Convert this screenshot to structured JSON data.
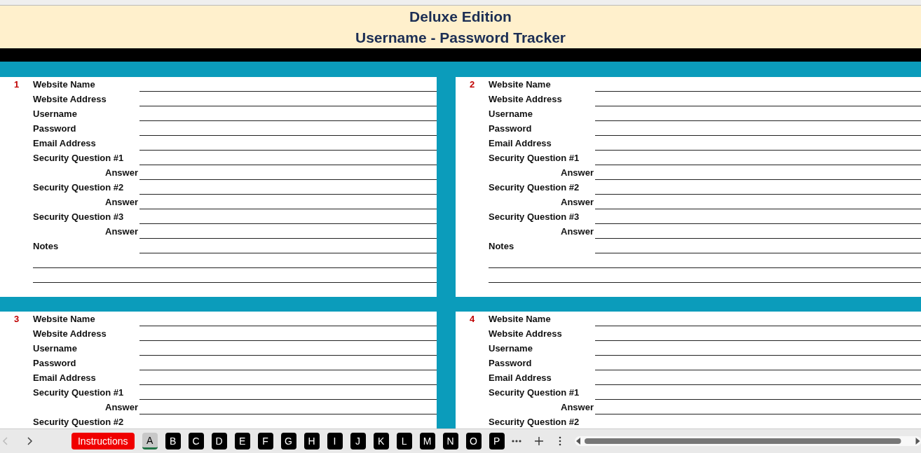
{
  "title": {
    "edition": "Deluxe Edition",
    "name": "Username - Password Tracker"
  },
  "records": [
    {
      "number": "1",
      "fields": [
        {
          "label": "Website Name",
          "kind": "field"
        },
        {
          "label": "Website Address",
          "kind": "field"
        },
        {
          "label": "Username",
          "kind": "field"
        },
        {
          "label": "Password",
          "kind": "field"
        },
        {
          "label": "Email Address",
          "kind": "field"
        },
        {
          "label": "Security Question #1",
          "kind": "field"
        },
        {
          "label": "Answer",
          "kind": "answer"
        },
        {
          "label": "Security Question #2",
          "kind": "field"
        },
        {
          "label": "Answer",
          "kind": "answer"
        },
        {
          "label": "Security Question #3",
          "kind": "field"
        },
        {
          "label": "Answer",
          "kind": "answer"
        },
        {
          "label": "Notes",
          "kind": "notes"
        }
      ]
    },
    {
      "number": "2",
      "fields": [
        {
          "label": "Website Name",
          "kind": "field"
        },
        {
          "label": "Website Address",
          "kind": "field"
        },
        {
          "label": "Username",
          "kind": "field"
        },
        {
          "label": "Password",
          "kind": "field"
        },
        {
          "label": "Email Address",
          "kind": "field"
        },
        {
          "label": "Security Question #1",
          "kind": "field"
        },
        {
          "label": "Answer",
          "kind": "answer"
        },
        {
          "label": "Security Question #2",
          "kind": "field"
        },
        {
          "label": "Answer",
          "kind": "answer"
        },
        {
          "label": "Security Question #3",
          "kind": "field"
        },
        {
          "label": "Answer",
          "kind": "answer"
        },
        {
          "label": "Notes",
          "kind": "notes"
        }
      ]
    },
    {
      "number": "3",
      "fields": [
        {
          "label": "Website Name",
          "kind": "field"
        },
        {
          "label": "Website Address",
          "kind": "field"
        },
        {
          "label": "Username",
          "kind": "field"
        },
        {
          "label": "Password",
          "kind": "field"
        },
        {
          "label": "Email Address",
          "kind": "field"
        },
        {
          "label": "Security Question #1",
          "kind": "field"
        },
        {
          "label": "Answer",
          "kind": "answer"
        },
        {
          "label": "Security Question #2",
          "kind": "field"
        }
      ]
    },
    {
      "number": "4",
      "fields": [
        {
          "label": "Website Name",
          "kind": "field"
        },
        {
          "label": "Website Address",
          "kind": "field"
        },
        {
          "label": "Username",
          "kind": "field"
        },
        {
          "label": "Password",
          "kind": "field"
        },
        {
          "label": "Email Address",
          "kind": "field"
        },
        {
          "label": "Security Question #1",
          "kind": "field"
        },
        {
          "label": "Answer",
          "kind": "answer"
        },
        {
          "label": "Security Question #2",
          "kind": "field"
        }
      ]
    }
  ],
  "sheet_tabs": [
    {
      "label": "Instructions",
      "kind": "instructions",
      "selected": false
    },
    {
      "label": "A",
      "kind": "letter",
      "selected": true
    },
    {
      "label": "B",
      "kind": "letter",
      "selected": false
    },
    {
      "label": "C",
      "kind": "letter",
      "selected": false
    },
    {
      "label": "D",
      "kind": "letter",
      "selected": false
    },
    {
      "label": "E",
      "kind": "letter",
      "selected": false
    },
    {
      "label": "F",
      "kind": "letter",
      "selected": false
    },
    {
      "label": "G",
      "kind": "letter",
      "selected": false
    },
    {
      "label": "H",
      "kind": "letter",
      "selected": false
    },
    {
      "label": "I",
      "kind": "letter",
      "selected": false
    },
    {
      "label": "J",
      "kind": "letter",
      "selected": false
    },
    {
      "label": "K",
      "kind": "letter",
      "selected": false
    },
    {
      "label": "L",
      "kind": "letter",
      "selected": false
    },
    {
      "label": "M",
      "kind": "letter",
      "selected": false
    },
    {
      "label": "N",
      "kind": "letter",
      "selected": false
    },
    {
      "label": "O",
      "kind": "letter",
      "selected": false
    },
    {
      "label": "P",
      "kind": "letter",
      "selected": false
    }
  ]
}
